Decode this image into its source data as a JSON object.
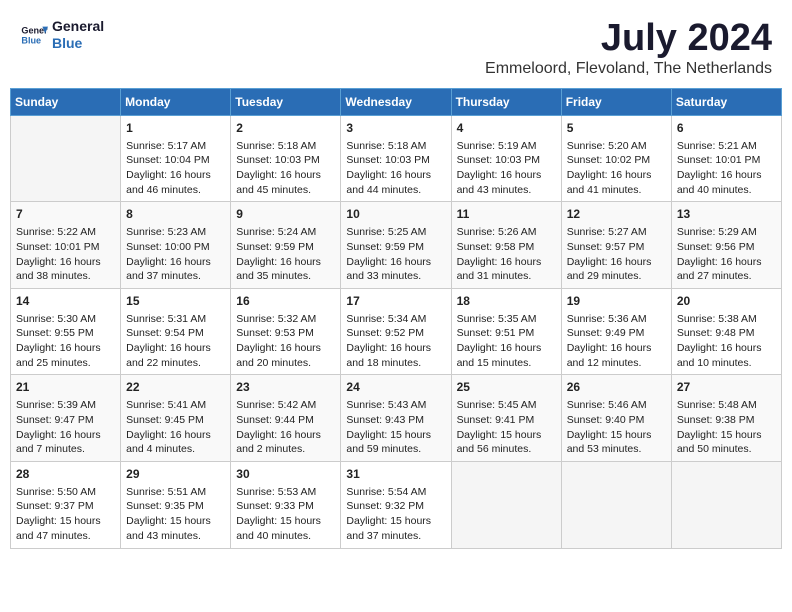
{
  "logo": {
    "line1": "General",
    "line2": "Blue"
  },
  "title": "July 2024",
  "location": "Emmeloord, Flevoland, The Netherlands",
  "weekdays": [
    "Sunday",
    "Monday",
    "Tuesday",
    "Wednesday",
    "Thursday",
    "Friday",
    "Saturday"
  ],
  "weeks": [
    [
      {
        "day": "",
        "content": ""
      },
      {
        "day": "1",
        "content": "Sunrise: 5:17 AM\nSunset: 10:04 PM\nDaylight: 16 hours\nand 46 minutes."
      },
      {
        "day": "2",
        "content": "Sunrise: 5:18 AM\nSunset: 10:03 PM\nDaylight: 16 hours\nand 45 minutes."
      },
      {
        "day": "3",
        "content": "Sunrise: 5:18 AM\nSunset: 10:03 PM\nDaylight: 16 hours\nand 44 minutes."
      },
      {
        "day": "4",
        "content": "Sunrise: 5:19 AM\nSunset: 10:03 PM\nDaylight: 16 hours\nand 43 minutes."
      },
      {
        "day": "5",
        "content": "Sunrise: 5:20 AM\nSunset: 10:02 PM\nDaylight: 16 hours\nand 41 minutes."
      },
      {
        "day": "6",
        "content": "Sunrise: 5:21 AM\nSunset: 10:01 PM\nDaylight: 16 hours\nand 40 minutes."
      }
    ],
    [
      {
        "day": "7",
        "content": "Sunrise: 5:22 AM\nSunset: 10:01 PM\nDaylight: 16 hours\nand 38 minutes."
      },
      {
        "day": "8",
        "content": "Sunrise: 5:23 AM\nSunset: 10:00 PM\nDaylight: 16 hours\nand 37 minutes."
      },
      {
        "day": "9",
        "content": "Sunrise: 5:24 AM\nSunset: 9:59 PM\nDaylight: 16 hours\nand 35 minutes."
      },
      {
        "day": "10",
        "content": "Sunrise: 5:25 AM\nSunset: 9:59 PM\nDaylight: 16 hours\nand 33 minutes."
      },
      {
        "day": "11",
        "content": "Sunrise: 5:26 AM\nSunset: 9:58 PM\nDaylight: 16 hours\nand 31 minutes."
      },
      {
        "day": "12",
        "content": "Sunrise: 5:27 AM\nSunset: 9:57 PM\nDaylight: 16 hours\nand 29 minutes."
      },
      {
        "day": "13",
        "content": "Sunrise: 5:29 AM\nSunset: 9:56 PM\nDaylight: 16 hours\nand 27 minutes."
      }
    ],
    [
      {
        "day": "14",
        "content": "Sunrise: 5:30 AM\nSunset: 9:55 PM\nDaylight: 16 hours\nand 25 minutes."
      },
      {
        "day": "15",
        "content": "Sunrise: 5:31 AM\nSunset: 9:54 PM\nDaylight: 16 hours\nand 22 minutes."
      },
      {
        "day": "16",
        "content": "Sunrise: 5:32 AM\nSunset: 9:53 PM\nDaylight: 16 hours\nand 20 minutes."
      },
      {
        "day": "17",
        "content": "Sunrise: 5:34 AM\nSunset: 9:52 PM\nDaylight: 16 hours\nand 18 minutes."
      },
      {
        "day": "18",
        "content": "Sunrise: 5:35 AM\nSunset: 9:51 PM\nDaylight: 16 hours\nand 15 minutes."
      },
      {
        "day": "19",
        "content": "Sunrise: 5:36 AM\nSunset: 9:49 PM\nDaylight: 16 hours\nand 12 minutes."
      },
      {
        "day": "20",
        "content": "Sunrise: 5:38 AM\nSunset: 9:48 PM\nDaylight: 16 hours\nand 10 minutes."
      }
    ],
    [
      {
        "day": "21",
        "content": "Sunrise: 5:39 AM\nSunset: 9:47 PM\nDaylight: 16 hours\nand 7 minutes."
      },
      {
        "day": "22",
        "content": "Sunrise: 5:41 AM\nSunset: 9:45 PM\nDaylight: 16 hours\nand 4 minutes."
      },
      {
        "day": "23",
        "content": "Sunrise: 5:42 AM\nSunset: 9:44 PM\nDaylight: 16 hours\nand 2 minutes."
      },
      {
        "day": "24",
        "content": "Sunrise: 5:43 AM\nSunset: 9:43 PM\nDaylight: 15 hours\nand 59 minutes."
      },
      {
        "day": "25",
        "content": "Sunrise: 5:45 AM\nSunset: 9:41 PM\nDaylight: 15 hours\nand 56 minutes."
      },
      {
        "day": "26",
        "content": "Sunrise: 5:46 AM\nSunset: 9:40 PM\nDaylight: 15 hours\nand 53 minutes."
      },
      {
        "day": "27",
        "content": "Sunrise: 5:48 AM\nSunset: 9:38 PM\nDaylight: 15 hours\nand 50 minutes."
      }
    ],
    [
      {
        "day": "28",
        "content": "Sunrise: 5:50 AM\nSunset: 9:37 PM\nDaylight: 15 hours\nand 47 minutes."
      },
      {
        "day": "29",
        "content": "Sunrise: 5:51 AM\nSunset: 9:35 PM\nDaylight: 15 hours\nand 43 minutes."
      },
      {
        "day": "30",
        "content": "Sunrise: 5:53 AM\nSunset: 9:33 PM\nDaylight: 15 hours\nand 40 minutes."
      },
      {
        "day": "31",
        "content": "Sunrise: 5:54 AM\nSunset: 9:32 PM\nDaylight: 15 hours\nand 37 minutes."
      },
      {
        "day": "",
        "content": ""
      },
      {
        "day": "",
        "content": ""
      },
      {
        "day": "",
        "content": ""
      }
    ]
  ]
}
